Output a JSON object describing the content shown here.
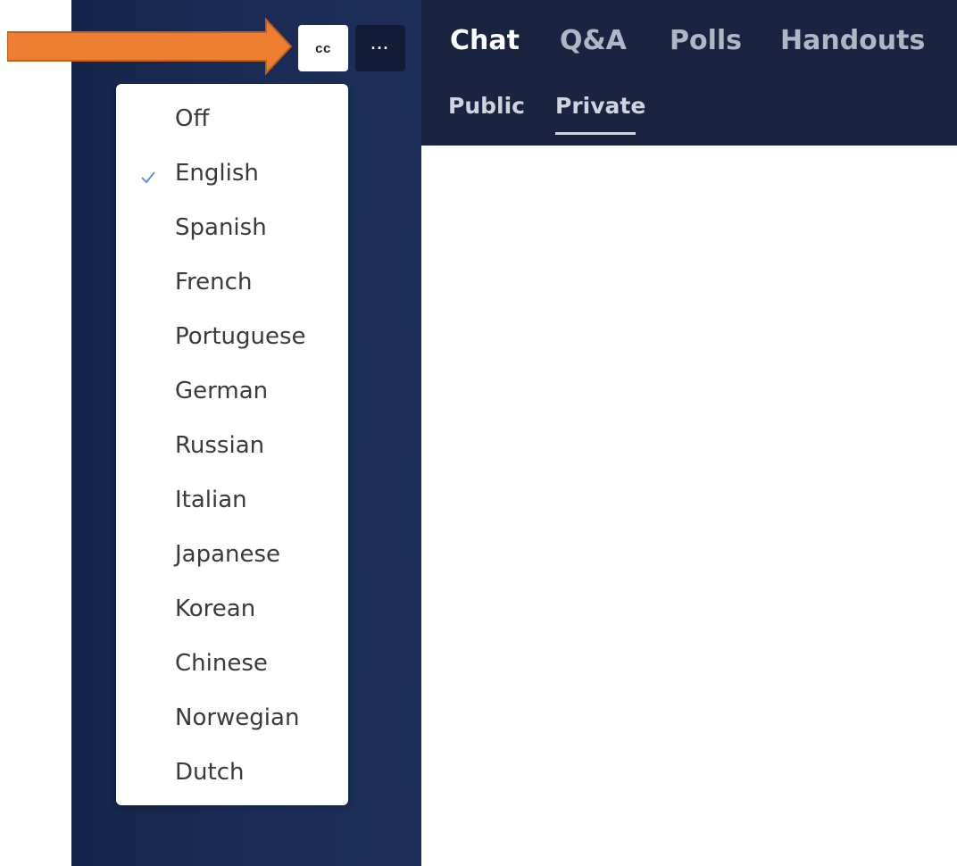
{
  "header": {
    "tabs": [
      {
        "label": "Chat",
        "active": true
      },
      {
        "label": "Q&A",
        "active": false
      },
      {
        "label": "Polls",
        "active": false
      },
      {
        "label": "Handouts",
        "active": false
      }
    ],
    "subtabs": [
      {
        "label": "Public",
        "active": false
      },
      {
        "label": "Private",
        "active": true
      }
    ]
  },
  "controls": {
    "cc_label": "cc",
    "more_label": "···"
  },
  "captions_menu": {
    "selected": "English",
    "check_icon": "check-icon",
    "items": [
      {
        "label": "Off"
      },
      {
        "label": "English"
      },
      {
        "label": "Spanish"
      },
      {
        "label": "French"
      },
      {
        "label": "Portuguese"
      },
      {
        "label": "German"
      },
      {
        "label": "Russian"
      },
      {
        "label": "Italian"
      },
      {
        "label": "Japanese"
      },
      {
        "label": "Korean"
      },
      {
        "label": "Chinese"
      },
      {
        "label": "Norwegian"
      },
      {
        "label": "Dutch"
      }
    ]
  },
  "colors": {
    "panel": "#1a2c55",
    "header": "#1a2340",
    "arrow": "#ed7d31",
    "check": "#4a90d9"
  }
}
